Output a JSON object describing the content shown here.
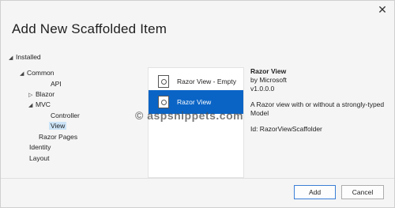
{
  "dialog": {
    "title": "Add New Scaffolded Item",
    "close_glyph": "✕"
  },
  "tree": {
    "installed": "Installed",
    "common": "Common",
    "api": "API",
    "blazor": "Blazor",
    "mvc": "MVC",
    "controller": "Controller",
    "view": "View",
    "razor_pages": "Razor Pages",
    "identity": "Identity",
    "layout": "Layout",
    "expanded_glyph": "◢",
    "collapsed_glyph": "▷"
  },
  "templates": [
    {
      "label": "Razor View - Empty",
      "icon": "file-template-icon",
      "selected": false
    },
    {
      "label": "Razor View",
      "icon": "file-template-icon",
      "selected": true
    }
  ],
  "details": {
    "name": "Razor View",
    "author": "by Microsoft",
    "version": "v1.0.0.0",
    "description": "A Razor view with or without a strongly-typed Model",
    "id": "Id: RazorViewScaffolder"
  },
  "watermark": "© aspsnippets.com",
  "buttons": {
    "add": "Add",
    "cancel": "Cancel"
  },
  "colors": {
    "selection": "#0a64c6",
    "tree_selection": "#cce4f7"
  }
}
